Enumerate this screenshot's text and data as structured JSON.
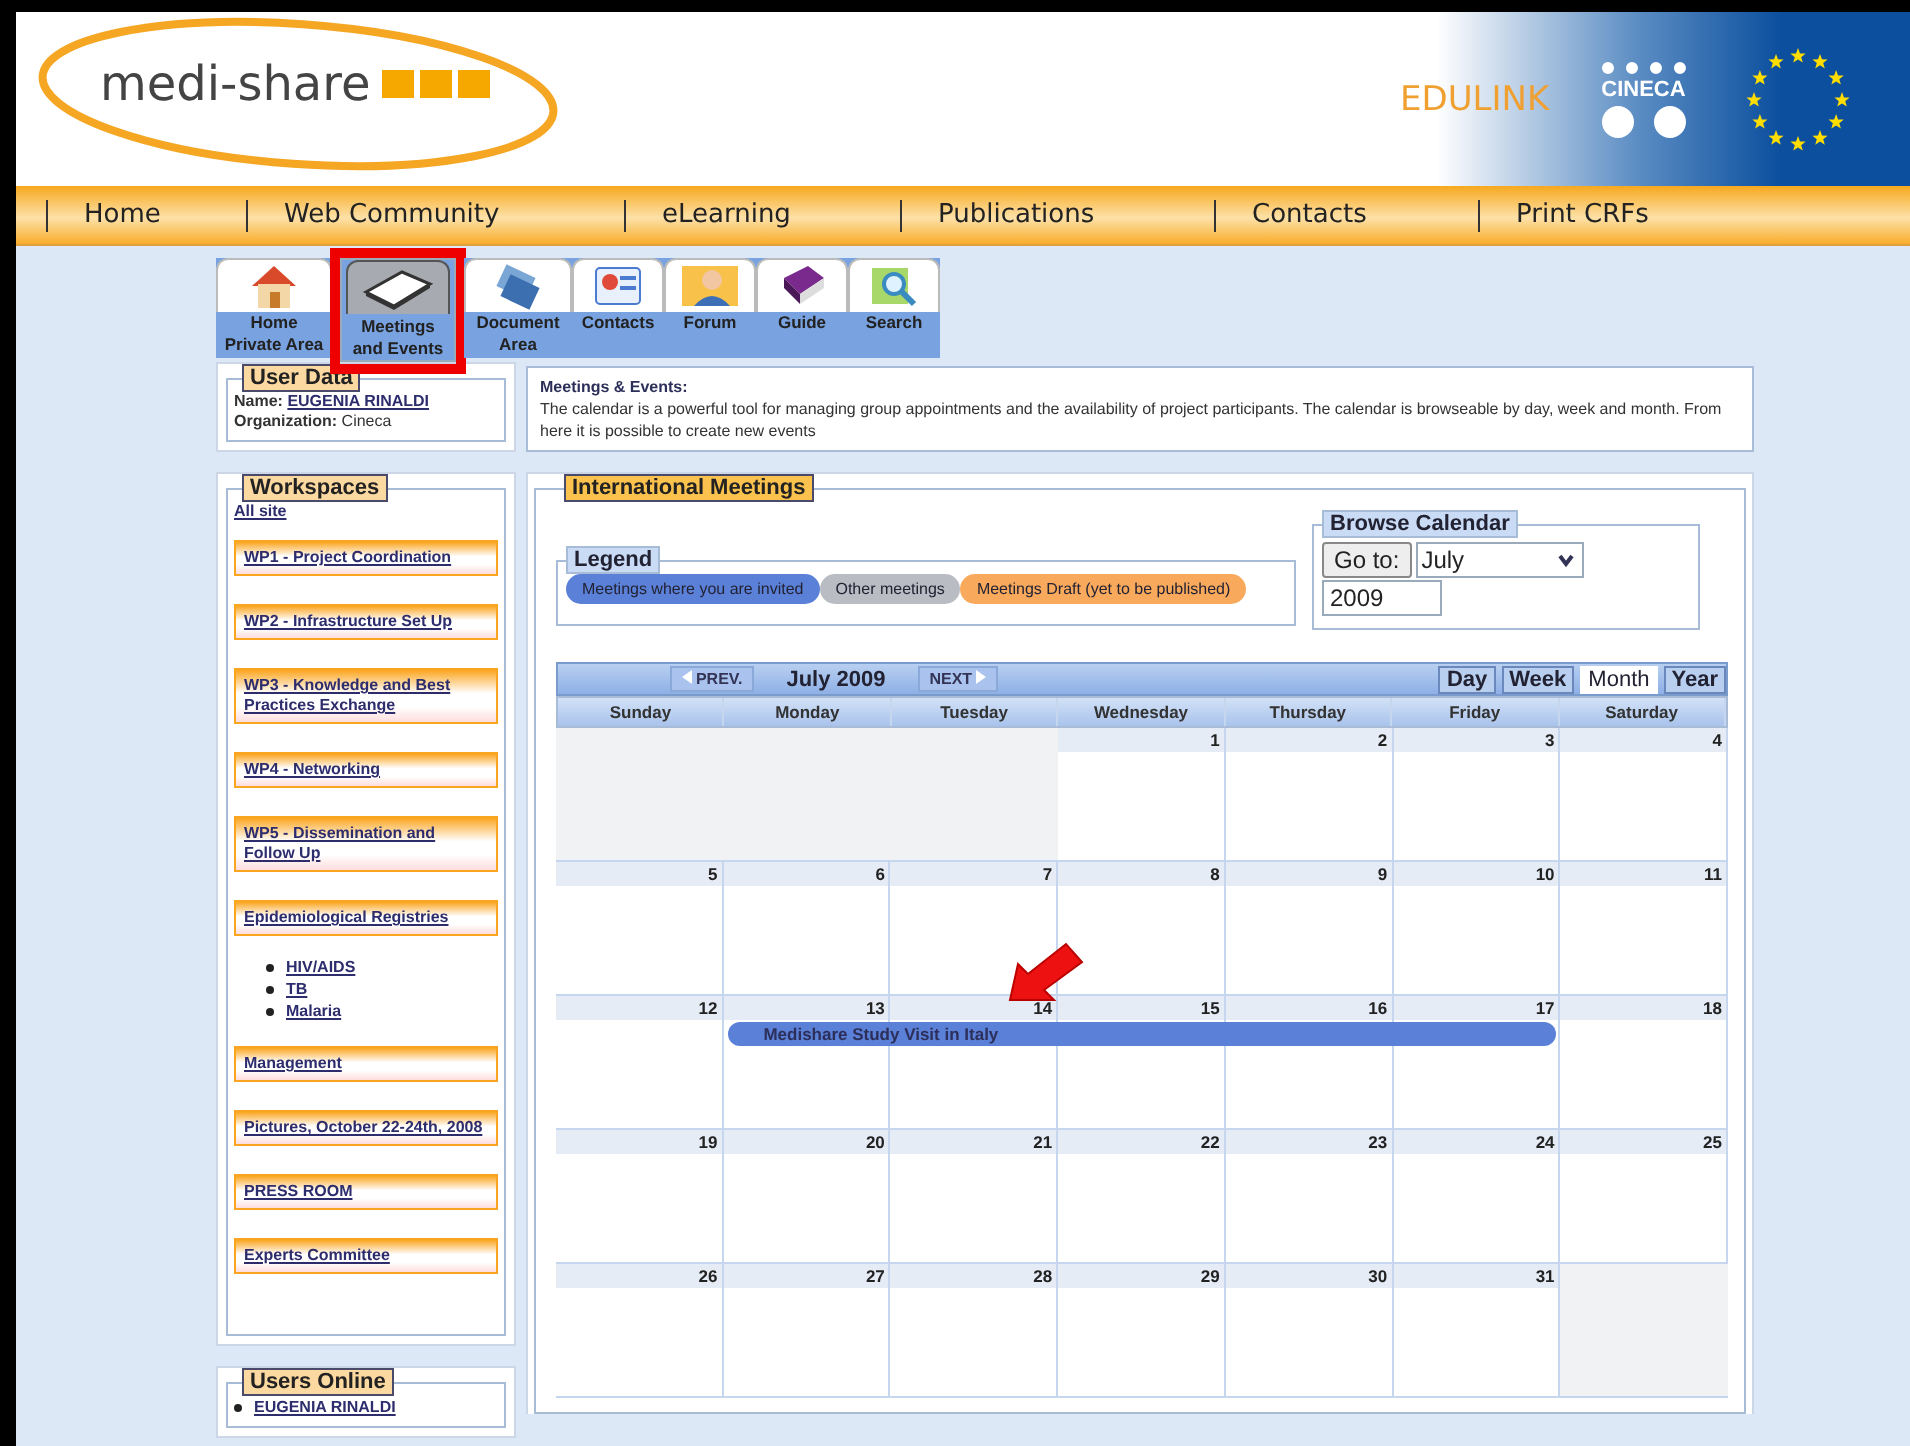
{
  "header": {
    "logo": "medi-share",
    "partner_logo": "EDULINK",
    "partner_logo_2": "CINECA"
  },
  "nav": [
    "Home",
    "Web Community",
    "eLearning",
    "Publications",
    "Contacts",
    "Print CRFs"
  ],
  "toolbar": [
    {
      "label": [
        "Home",
        "Private Area"
      ],
      "selected": false,
      "highlighted": false
    },
    {
      "label": [
        "Meetings",
        "and Events"
      ],
      "selected": true,
      "highlighted": true
    },
    {
      "label": [
        "Document",
        "Area"
      ],
      "selected": false,
      "highlighted": false
    },
    {
      "label": [
        "Contacts"
      ],
      "selected": false,
      "highlighted": false
    },
    {
      "label": [
        "Forum"
      ],
      "selected": false,
      "highlighted": false
    },
    {
      "label": [
        "Guide"
      ],
      "selected": false,
      "highlighted": false
    },
    {
      "label": [
        "Search"
      ],
      "selected": false,
      "highlighted": false
    }
  ],
  "user_data": {
    "title": "User Data",
    "name_label": "Name:",
    "name": "EUGENIA RINALDI",
    "org_label": "Organization:",
    "org": "Cineca"
  },
  "workspaces": {
    "title": "Workspaces",
    "all_site": "All site",
    "items": [
      {
        "label": "WP1 - Project Coordination"
      },
      {
        "label": "WP2 - Infrastructure Set Up"
      },
      {
        "label": "WP3 - Knowledge and Best Practices Exchange"
      },
      {
        "label": "WP4 - Networking"
      },
      {
        "label": "WP5 - Dissemination and Follow Up"
      },
      {
        "label": "Epidemiological Registries",
        "children": [
          "HIV/AIDS",
          "TB",
          "Malaria"
        ]
      },
      {
        "label": "Management"
      },
      {
        "label": "Pictures, October 22-24th, 2008"
      },
      {
        "label": "PRESS ROOM"
      },
      {
        "label": "Experts Committee"
      }
    ]
  },
  "users_online": {
    "title": "Users Online",
    "users": [
      "EUGENIA RINALDI"
    ]
  },
  "intro": {
    "title": "Meetings & Events:",
    "text": "The calendar is a powerful tool for managing group appointments and the availability of project participants. The calendar is browseable by day, week and month. From here it is possible to create new events"
  },
  "meetings": {
    "title": "International Meetings",
    "legend": {
      "title": "Legend",
      "items": [
        {
          "label": "Meetings where you are invited",
          "color": "#5b80d8"
        },
        {
          "label": "Other meetings",
          "color": "#b9bcc2"
        },
        {
          "label": "Meetings Draft (yet to be published)",
          "color": "#f9a95c"
        }
      ]
    },
    "browse": {
      "title": "Browse Calendar",
      "goto": "Go to:",
      "month": "July",
      "year": "2009"
    },
    "calendar": {
      "prev": "PREV.",
      "title": "July 2009",
      "next": "NEXT",
      "views": [
        {
          "label": "Day",
          "selected": false
        },
        {
          "label": "Week",
          "selected": false
        },
        {
          "label": "Month",
          "selected": true
        },
        {
          "label": "Year",
          "selected": false
        }
      ],
      "days": [
        "Sunday",
        "Monday",
        "Tuesday",
        "Wednesday",
        "Thursday",
        "Friday",
        "Saturday"
      ],
      "weeks": [
        {
          "cells": [
            {
              "kind": "empty"
            },
            {
              "kind": "empty"
            },
            {
              "kind": "empty"
            },
            {
              "kind": "day",
              "day": "1"
            },
            {
              "kind": "day",
              "day": "2"
            },
            {
              "kind": "day",
              "day": "3"
            },
            {
              "kind": "day",
              "day": "4"
            }
          ]
        },
        {
          "cells": [
            {
              "kind": "day",
              "day": "5"
            },
            {
              "kind": "day",
              "day": "6"
            },
            {
              "kind": "day",
              "day": "7"
            },
            {
              "kind": "day",
              "day": "8"
            },
            {
              "kind": "day",
              "day": "9"
            },
            {
              "kind": "day",
              "day": "10"
            },
            {
              "kind": "day",
              "day": "11"
            }
          ]
        },
        {
          "cells": [
            {
              "kind": "day",
              "day": "12",
              "event": false
            },
            {
              "kind": "day",
              "day": "13",
              "event": true
            },
            {
              "kind": "day",
              "day": "14",
              "event": true
            },
            {
              "kind": "day",
              "day": "15",
              "event": true
            },
            {
              "kind": "day",
              "day": "16",
              "event": true
            },
            {
              "kind": "day",
              "day": "17",
              "event": true
            },
            {
              "kind": "day",
              "day": "18",
              "event": false
            }
          ],
          "event": {
            "title": "Medishare Study Visit in Italy",
            "color": "#5b80d8"
          }
        },
        {
          "cells": [
            {
              "kind": "day",
              "day": "19"
            },
            {
              "kind": "day",
              "day": "20"
            },
            {
              "kind": "day",
              "day": "21"
            },
            {
              "kind": "day",
              "day": "22"
            },
            {
              "kind": "day",
              "day": "23"
            },
            {
              "kind": "day",
              "day": "24"
            },
            {
              "kind": "day",
              "day": "25"
            }
          ]
        },
        {
          "cells": [
            {
              "kind": "day",
              "day": "26"
            },
            {
              "kind": "day",
              "day": "27"
            },
            {
              "kind": "day",
              "day": "28"
            },
            {
              "kind": "day",
              "day": "29"
            },
            {
              "kind": "day",
              "day": "30"
            },
            {
              "kind": "day",
              "day": "31"
            },
            {
              "kind": "empty"
            }
          ]
        }
      ]
    }
  }
}
